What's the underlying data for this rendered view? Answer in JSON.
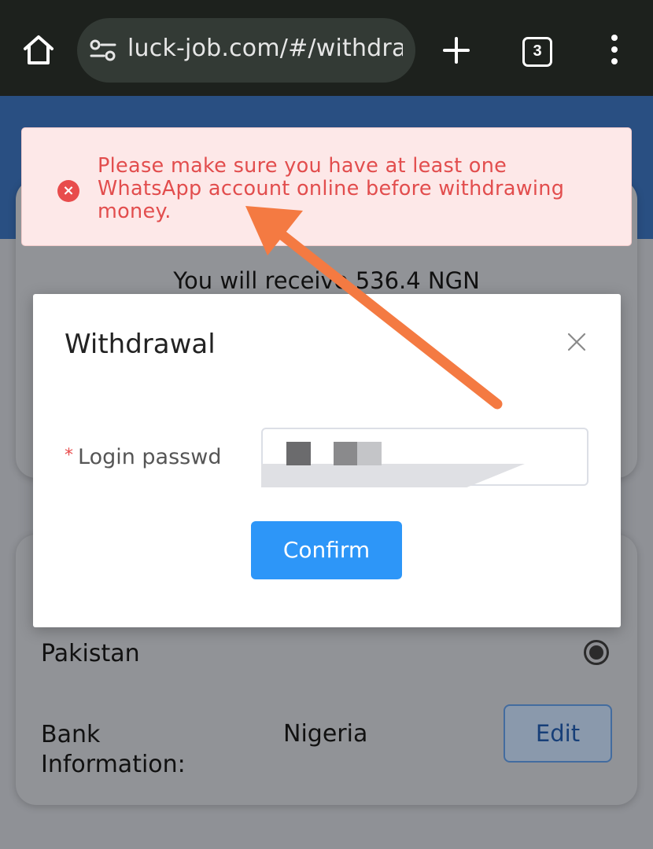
{
  "browser": {
    "url": "luck-job.com/#/withdraw",
    "tab_count": "3"
  },
  "page": {
    "receive_text": "You will receive 536.4 NGN",
    "country": "Pakistan",
    "bank_label": "Bank Information:",
    "bank_value": "Nigeria",
    "edit_label": "Edit"
  },
  "alert": {
    "message": "Please make sure you have at least one WhatsApp account online before withdrawing money.",
    "color": "#e24d4d"
  },
  "modal": {
    "title": "Withdrawal",
    "field_required_mark": "*",
    "field_label": "Login passwd",
    "confirm_label": "Confirm"
  },
  "colors": {
    "primary": "#2d96f8",
    "annotation_arrow": "#f47a42"
  }
}
